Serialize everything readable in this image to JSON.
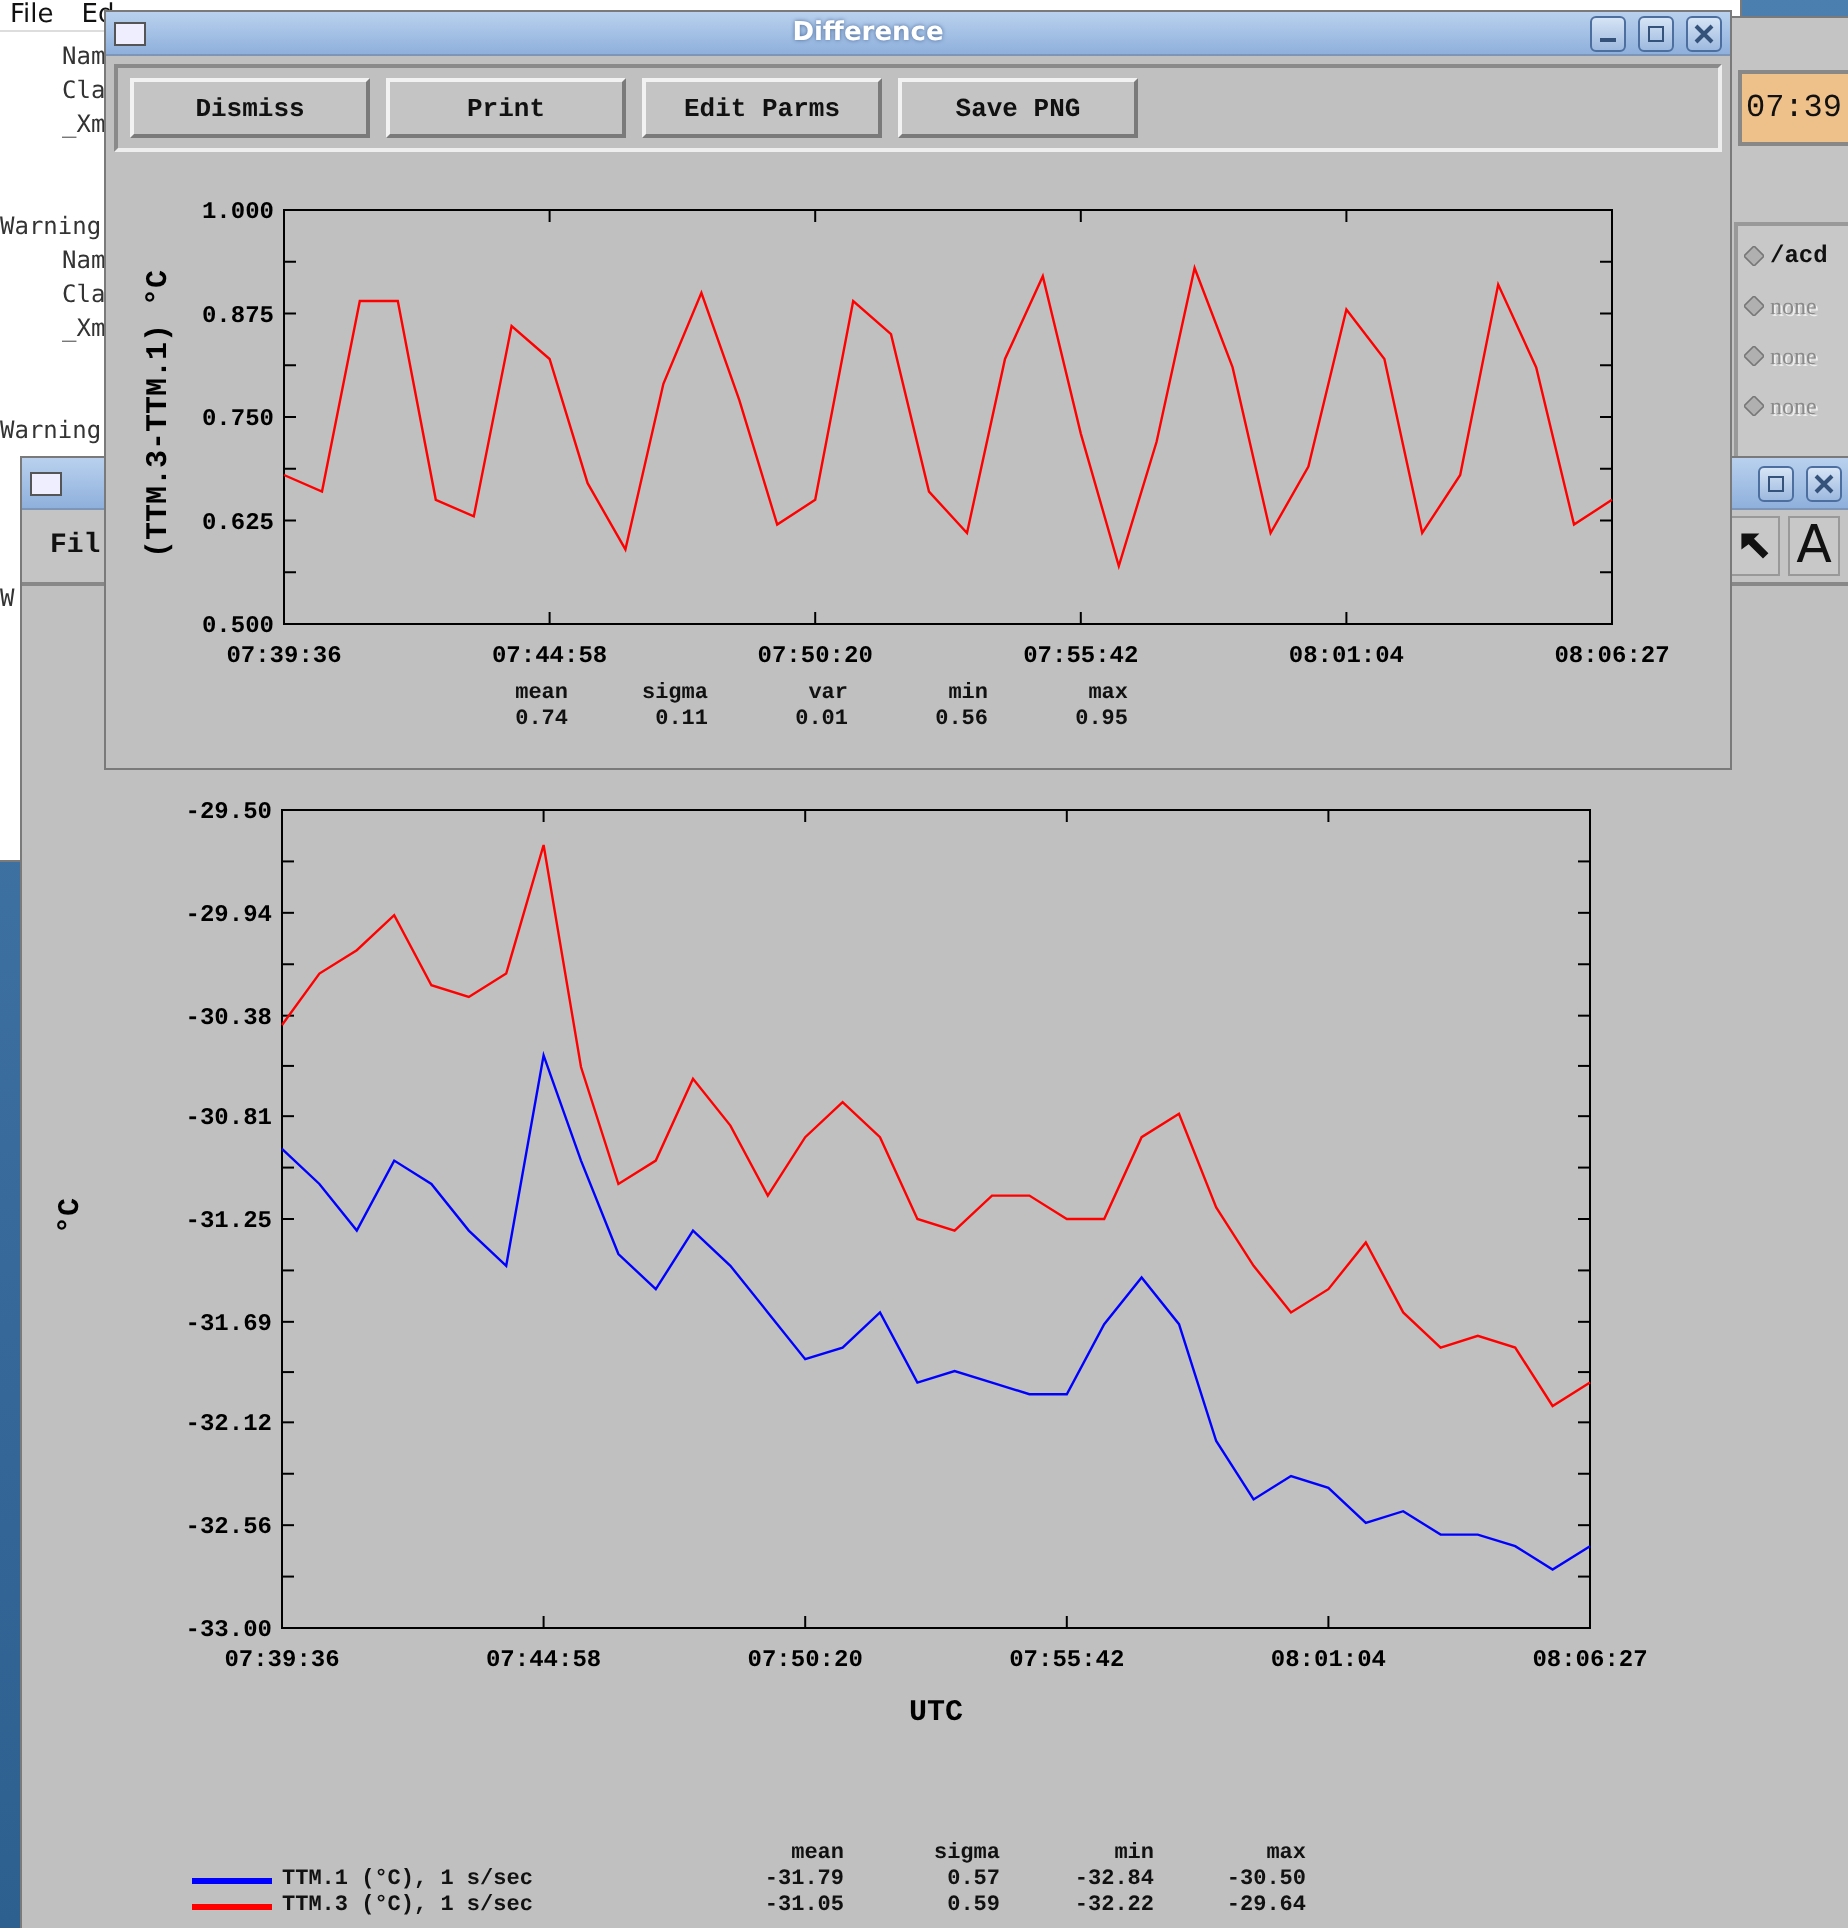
{
  "terminal": {
    "menu": [
      "File",
      "Ed"
    ],
    "lines": [
      {
        "text": "Nam",
        "kind": "detail"
      },
      {
        "text": "Cla",
        "kind": "detail"
      },
      {
        "text": "_Xm",
        "kind": "detail"
      },
      {
        "text": "Warning",
        "kind": "warning"
      },
      {
        "text": "Nam",
        "kind": "detail"
      },
      {
        "text": "Cla",
        "kind": "detail"
      },
      {
        "text": "_Xm",
        "kind": "detail"
      },
      {
        "text": "Warning",
        "kind": "warning"
      }
    ],
    "lower_lines": [
      {
        "text": "W",
        "kind": "warning"
      }
    ]
  },
  "side_window": {
    "time": "07:39",
    "options": [
      {
        "label": "/acd",
        "disabled": false
      },
      {
        "label": "none",
        "disabled": true
      },
      {
        "label": "none",
        "disabled": true
      },
      {
        "label": "none",
        "disabled": true
      }
    ]
  },
  "main_window": {
    "menu": [
      "Fil"
    ],
    "toolbar": [
      {
        "kind": "pointer"
      },
      {
        "kind": "text",
        "label": "A"
      }
    ],
    "chart_data": {
      "type": "line",
      "xlabel": "UTC",
      "ylabel": "°C",
      "ylim": [
        -33.0,
        -29.5
      ],
      "categories": [
        "07:39:36",
        null,
        null,
        null,
        null,
        null,
        null,
        "07:44:58",
        null,
        null,
        null,
        null,
        null,
        null,
        "07:50:20",
        null,
        null,
        null,
        null,
        null,
        null,
        "07:55:42",
        null,
        null,
        null,
        null,
        null,
        null,
        "08:01:04",
        null,
        null,
        null,
        null,
        null,
        null,
        "08:06:27"
      ],
      "yticks": [
        {
          "value": -29.5,
          "label": "-29.50"
        },
        {
          "value": -29.94,
          "label": "-29.94"
        },
        {
          "value": -30.38,
          "label": "-30.38"
        },
        {
          "value": -30.81,
          "label": "-30.81"
        },
        {
          "value": -31.25,
          "label": "-31.25"
        },
        {
          "value": -31.69,
          "label": "-31.69"
        },
        {
          "value": -32.12,
          "label": "-32.12"
        },
        {
          "value": -32.56,
          "label": "-32.56"
        },
        {
          "value": -33.0,
          "label": "-33.00"
        }
      ],
      "series": [
        {
          "color": "#0000ff",
          "values": [
            -30.95,
            -31.1,
            -31.3,
            -31.0,
            -31.1,
            -31.3,
            -31.45,
            -30.55,
            -31.0,
            -31.4,
            -31.55,
            -31.3,
            -31.45,
            -31.65,
            -31.85,
            -31.8,
            -31.65,
            -31.95,
            -31.9,
            -31.95,
            -32.0,
            -32.0,
            -31.7,
            -31.5,
            -31.7,
            -32.2,
            -32.45,
            -32.35,
            -32.4,
            -32.55,
            -32.5,
            -32.6,
            -32.6,
            -32.65,
            -32.75,
            -32.65
          ]
        },
        {
          "color": "#ff0000",
          "values": [
            -30.42,
            -30.2,
            -30.1,
            -29.95,
            -30.25,
            -30.3,
            -30.2,
            -29.65,
            -30.6,
            -31.1,
            -31.0,
            -30.65,
            -30.85,
            -31.15,
            -30.9,
            -30.75,
            -30.9,
            -31.25,
            -31.3,
            -31.15,
            -31.15,
            -31.25,
            -31.25,
            -30.9,
            -30.8,
            -31.2,
            -31.45,
            -31.65,
            -31.55,
            -31.35,
            -31.65,
            -31.8,
            -31.75,
            -31.8,
            -32.05,
            -31.95
          ]
        }
      ]
    },
    "legend": {
      "columns": [
        "mean",
        "sigma",
        "min",
        "max"
      ],
      "rows": [
        {
          "name": "TTM.1 (°C), 1 s/sec",
          "color": "#0000ff",
          "values": [
            "-31.79",
            "0.57",
            "-32.84",
            "-30.50"
          ]
        },
        {
          "name": "TTM.3 (°C), 1 s/sec",
          "color": "#ff0000",
          "values": [
            "-31.05",
            "0.59",
            "-32.22",
            "-29.64"
          ]
        }
      ]
    }
  },
  "difference_window": {
    "title": "Difference",
    "buttons": [
      "Dismiss",
      "Print",
      "Edit Parms",
      "Save PNG"
    ],
    "chart_data": {
      "type": "line",
      "ylabel": "(TTM.3-TTM.1) °C",
      "ylim": [
        0.5,
        1.0
      ],
      "categories": [
        "07:39:36",
        null,
        null,
        null,
        null,
        null,
        null,
        "07:44:58",
        null,
        null,
        null,
        null,
        null,
        null,
        "07:50:20",
        null,
        null,
        null,
        null,
        null,
        null,
        "07:55:42",
        null,
        null,
        null,
        null,
        null,
        null,
        "08:01:04",
        null,
        null,
        null,
        null,
        null,
        null,
        "08:06:27"
      ],
      "yticks": [
        {
          "value": 0.5,
          "label": "0.500"
        },
        {
          "value": 0.625,
          "label": "0.625"
        },
        {
          "value": 0.75,
          "label": "0.750"
        },
        {
          "value": 0.875,
          "label": "0.875"
        },
        {
          "value": 1.0,
          "label": "1.000"
        }
      ],
      "series": [
        {
          "color": "#ff0000",
          "values": [
            0.68,
            0.66,
            0.89,
            0.89,
            0.65,
            0.63,
            0.86,
            0.82,
            0.67,
            0.59,
            0.79,
            0.9,
            0.77,
            0.62,
            0.65,
            0.89,
            0.85,
            0.66,
            0.61,
            0.82,
            0.92,
            0.73,
            0.57,
            0.72,
            0.93,
            0.81,
            0.61,
            0.69,
            0.88,
            0.82,
            0.61,
            0.68,
            0.91,
            0.81,
            0.62,
            0.65
          ]
        }
      ]
    },
    "stats": [
      {
        "label": "mean",
        "value": "0.74"
      },
      {
        "label": "sigma",
        "value": "0.11"
      },
      {
        "label": "var",
        "value": "0.01"
      },
      {
        "label": "min",
        "value": "0.56"
      },
      {
        "label": "max",
        "value": "0.95"
      }
    ]
  }
}
